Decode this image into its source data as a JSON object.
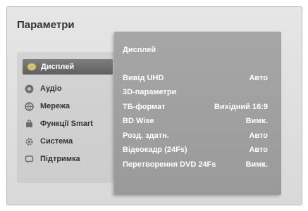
{
  "screen": {
    "title": "Параметри"
  },
  "menu": {
    "items": [
      {
        "label": "Дисплей",
        "icon": "display-icon",
        "selected": true
      },
      {
        "label": "Аудіо",
        "icon": "audio-icon",
        "selected": false
      },
      {
        "label": "Мережа",
        "icon": "network-icon",
        "selected": false
      },
      {
        "label": "Функції Smart",
        "icon": "smart-icon",
        "selected": false
      },
      {
        "label": "Система",
        "icon": "gear-icon",
        "selected": false
      },
      {
        "label": "Підтримка",
        "icon": "support-icon",
        "selected": false
      }
    ]
  },
  "display_panel": {
    "header": "Дисплей",
    "settings": [
      {
        "label": "Вивід UHD",
        "value": "Авто"
      },
      {
        "label": "3D-параметри",
        "value": ""
      },
      {
        "label": "ТБ-формат",
        "value": "Вихідний 16:9"
      },
      {
        "label": "BD Wise",
        "value": "Вимк."
      },
      {
        "label": "Розд. здатн.",
        "value": "Авто"
      },
      {
        "label": "Відеокадр (24Fs)",
        "value": "Авто"
      },
      {
        "label": "Перетворення DVD 24Fs",
        "value": "Вимк."
      }
    ]
  },
  "colors": {
    "selected_bg": "#6e6e6e",
    "panel_bg": "#a0a0a0",
    "text_dark": "#333333",
    "text_light": "#ffffff"
  }
}
